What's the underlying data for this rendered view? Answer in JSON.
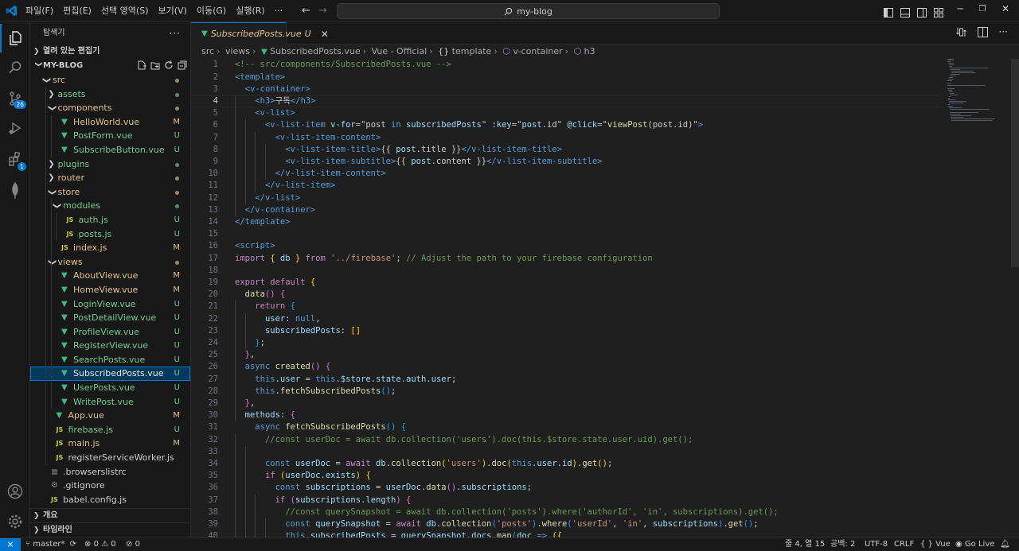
{
  "menus": [
    "파일(F)",
    "편집(E)",
    "선택 영역(S)",
    "보기(V)",
    "이동(G)",
    "실행(R)",
    "···"
  ],
  "command_center": "my-blog",
  "activity": {
    "source_control_badge": "26",
    "extensions_badge": "1"
  },
  "explorer": {
    "title": "탐색기",
    "open_editors": "열려 있는 편집기",
    "folder": "MY-BLOG",
    "tree": [
      {
        "label": "src",
        "depth": 0,
        "type": "folder",
        "open": true,
        "status": "dot-amber"
      },
      {
        "label": "assets",
        "depth": 1,
        "type": "folder",
        "open": false,
        "status": "dot-green"
      },
      {
        "label": "components",
        "depth": 1,
        "type": "folder",
        "open": true,
        "status": "dot-amber"
      },
      {
        "label": "HelloWorld.vue",
        "depth": 2,
        "type": "vue",
        "status": "M"
      },
      {
        "label": "PostForm.vue",
        "depth": 2,
        "type": "vue",
        "status": "U"
      },
      {
        "label": "SubscribeButton.vue",
        "depth": 2,
        "type": "vue",
        "status": "U"
      },
      {
        "label": "plugins",
        "depth": 1,
        "type": "folder",
        "open": false,
        "status": "dot-green"
      },
      {
        "label": "router",
        "depth": 1,
        "type": "folder",
        "open": false,
        "status": "dot-amber"
      },
      {
        "label": "store",
        "depth": 1,
        "type": "folder",
        "open": true,
        "status": "dot-amber"
      },
      {
        "label": "modules",
        "depth": 2,
        "type": "folder",
        "open": true,
        "status": "dot-green"
      },
      {
        "label": "auth.js",
        "depth": 3,
        "type": "js",
        "status": "U"
      },
      {
        "label": "posts.js",
        "depth": 3,
        "type": "js",
        "status": "U"
      },
      {
        "label": "index.js",
        "depth": 2,
        "type": "js",
        "status": "M"
      },
      {
        "label": "views",
        "depth": 1,
        "type": "folder",
        "open": true,
        "status": "dot-amber"
      },
      {
        "label": "AboutView.vue",
        "depth": 2,
        "type": "vue",
        "status": "M"
      },
      {
        "label": "HomeView.vue",
        "depth": 2,
        "type": "vue",
        "status": "M"
      },
      {
        "label": "LoginView.vue",
        "depth": 2,
        "type": "vue",
        "status": "U"
      },
      {
        "label": "PostDetailView.vue",
        "depth": 2,
        "type": "vue",
        "status": "U"
      },
      {
        "label": "ProfileView.vue",
        "depth": 2,
        "type": "vue",
        "status": "U"
      },
      {
        "label": "RegisterView.vue",
        "depth": 2,
        "type": "vue",
        "status": "U"
      },
      {
        "label": "SearchPosts.vue",
        "depth": 2,
        "type": "vue",
        "status": "U"
      },
      {
        "label": "SubscribedPosts.vue",
        "depth": 2,
        "type": "vue",
        "status": "U",
        "selected": true
      },
      {
        "label": "UserPosts.vue",
        "depth": 2,
        "type": "vue",
        "status": "U"
      },
      {
        "label": "WritePost.vue",
        "depth": 2,
        "type": "vue",
        "status": "U"
      },
      {
        "label": "App.vue",
        "depth": 1,
        "type": "vue",
        "status": "M"
      },
      {
        "label": "firebase.js",
        "depth": 1,
        "type": "js",
        "status": "U"
      },
      {
        "label": "main.js",
        "depth": 1,
        "type": "js",
        "status": "M"
      },
      {
        "label": "registerServiceWorker.js",
        "depth": 1,
        "type": "js",
        "status": ""
      },
      {
        "label": ".browserslistrc",
        "depth": 0,
        "type": "text",
        "status": ""
      },
      {
        "label": ".gitignore",
        "depth": 0,
        "type": "gear",
        "status": ""
      },
      {
        "label": "babel.config.js",
        "depth": 0,
        "type": "babel",
        "status": ""
      }
    ],
    "outline": "개요",
    "timeline": "타임라인"
  },
  "tab": {
    "name": "SubscribedPosts.vue",
    "status": "U"
  },
  "breadcrumb": [
    "src",
    "views",
    "SubscribedPosts.vue",
    "Vue - Official",
    "template",
    "v-container",
    "h3"
  ],
  "editor": {
    "current_line": 4,
    "lines": [
      [
        [
          "c-com",
          "<!-- src/components/SubscribedPosts.vue -->"
        ]
      ],
      [
        [
          "c-tag",
          "<template>"
        ]
      ],
      [
        [
          "",
          "  "
        ],
        [
          "c-tag",
          "<v-container>"
        ]
      ],
      [
        [
          "",
          "    "
        ],
        [
          "c-tag",
          "<h3>"
        ],
        [
          "",
          "구독"
        ],
        [
          "c-tag",
          "</h3>"
        ]
      ],
      [
        [
          "",
          "    "
        ],
        [
          "c-tag",
          "<v-list>"
        ]
      ],
      [
        [
          "",
          "      "
        ],
        [
          "c-tag",
          "<v-list-item "
        ],
        [
          "c-attr",
          "v-for"
        ],
        [
          "",
          "="
        ],
        [
          "",
          "\"post "
        ],
        [
          "c-blue",
          "in"
        ],
        [
          "c-var",
          " subscribedPosts"
        ],
        [
          "",
          "\" "
        ],
        [
          "c-attr",
          ":key"
        ],
        [
          "",
          "=\""
        ],
        [
          "c-var",
          "post"
        ],
        [
          "",
          ".id\" "
        ],
        [
          "c-attr",
          "@click"
        ],
        [
          "",
          "=\""
        ],
        [
          "c-fn",
          "viewPost"
        ],
        [
          "",
          "(post.id)\""
        ],
        [
          "c-tag",
          ">"
        ]
      ],
      [
        [
          "",
          "        "
        ],
        [
          "c-tag",
          "<v-list-item-content>"
        ]
      ],
      [
        [
          "",
          "          "
        ],
        [
          "c-tag",
          "<v-list-item-title>"
        ],
        [
          "",
          "{{ "
        ],
        [
          "c-var",
          "post"
        ],
        [
          "",
          ".title }}"
        ],
        [
          "c-tag",
          "</v-list-item-title>"
        ]
      ],
      [
        [
          "",
          "          "
        ],
        [
          "c-tag",
          "<v-list-item-subtitle>"
        ],
        [
          "",
          "{{ "
        ],
        [
          "c-var",
          "post"
        ],
        [
          "",
          ".content }}"
        ],
        [
          "c-tag",
          "</v-list-item-subtitle>"
        ]
      ],
      [
        [
          "",
          "        "
        ],
        [
          "c-tag",
          "</v-list-item-content>"
        ]
      ],
      [
        [
          "",
          "      "
        ],
        [
          "c-tag",
          "</v-list-item>"
        ]
      ],
      [
        [
          "",
          "    "
        ],
        [
          "c-tag",
          "</v-list>"
        ]
      ],
      [
        [
          "",
          "  "
        ],
        [
          "c-tag",
          "</v-container>"
        ]
      ],
      [
        [
          "c-tag",
          "</template>"
        ]
      ],
      [],
      [
        [
          "c-tag",
          "<script>"
        ]
      ],
      [
        [
          "c-kw",
          "import"
        ],
        [
          "",
          " "
        ],
        [
          "c-br",
          "{"
        ],
        [
          "c-var",
          " db "
        ],
        [
          "c-br",
          "}"
        ],
        [
          "c-kw",
          " from"
        ],
        [
          "",
          " "
        ],
        [
          "c-str",
          "'../firebase'"
        ],
        [
          "",
          "; "
        ],
        [
          "c-com",
          "// Adjust the path to your firebase configuration"
        ]
      ],
      [],
      [
        [
          "c-kw",
          "export default"
        ],
        [
          "",
          " "
        ],
        [
          "c-br",
          "{"
        ]
      ],
      [
        [
          "",
          "  "
        ],
        [
          "c-fn",
          "data"
        ],
        [
          "c-br2",
          "()"
        ],
        [
          "",
          " "
        ],
        [
          "c-br2",
          "{"
        ]
      ],
      [
        [
          "",
          "    "
        ],
        [
          "c-kw",
          "return"
        ],
        [
          "",
          " "
        ],
        [
          "c-br3",
          "{"
        ]
      ],
      [
        [
          "",
          "      "
        ],
        [
          "c-var",
          "user"
        ],
        [
          "",
          ": "
        ],
        [
          "c-blue",
          "null"
        ],
        [
          "",
          ","
        ]
      ],
      [
        [
          "",
          "      "
        ],
        [
          "c-var",
          "subscribedPosts"
        ],
        [
          "",
          ": "
        ],
        [
          "c-br",
          "[]"
        ]
      ],
      [
        [
          "",
          "    "
        ],
        [
          "c-br3",
          "}"
        ],
        [
          "",
          ";"
        ]
      ],
      [
        [
          "",
          "  "
        ],
        [
          "c-br2",
          "}"
        ],
        [
          "",
          ","
        ]
      ],
      [
        [
          "",
          "  "
        ],
        [
          "c-blue",
          "async"
        ],
        [
          "",
          " "
        ],
        [
          "c-fn",
          "created"
        ],
        [
          "c-br2",
          "()"
        ],
        [
          "",
          " "
        ],
        [
          "c-br2",
          "{"
        ]
      ],
      [
        [
          "",
          "    "
        ],
        [
          "c-blue",
          "this"
        ],
        [
          "",
          "."
        ],
        [
          "c-var",
          "user"
        ],
        [
          "",
          " = "
        ],
        [
          "c-blue",
          "this"
        ],
        [
          "",
          "."
        ],
        [
          "c-var",
          "$store"
        ],
        [
          "",
          "."
        ],
        [
          "c-var",
          "state"
        ],
        [
          "",
          "."
        ],
        [
          "c-var",
          "auth"
        ],
        [
          "",
          "."
        ],
        [
          "c-var",
          "user"
        ],
        [
          "",
          ";"
        ]
      ],
      [
        [
          "",
          "    "
        ],
        [
          "c-blue",
          "this"
        ],
        [
          "",
          "."
        ],
        [
          "c-fn",
          "fetchSubscribedPosts"
        ],
        [
          "c-br3",
          "()"
        ],
        [
          "",
          ";"
        ]
      ],
      [
        [
          "",
          "  "
        ],
        [
          "c-br2",
          "}"
        ],
        [
          "",
          ","
        ]
      ],
      [
        [
          "",
          "  "
        ],
        [
          "c-var",
          "methods"
        ],
        [
          "",
          ": "
        ],
        [
          "c-br2",
          "{"
        ]
      ],
      [
        [
          "",
          "    "
        ],
        [
          "c-blue",
          "async"
        ],
        [
          "",
          " "
        ],
        [
          "c-fn",
          "fetchSubscribedPosts"
        ],
        [
          "c-br3",
          "()"
        ],
        [
          "",
          " "
        ],
        [
          "c-br3",
          "{"
        ]
      ],
      [
        [
          "",
          "      "
        ],
        [
          "c-com",
          "//const userDoc = await db.collection('users').doc(this.$store.state.user.uid).get();"
        ]
      ],
      [],
      [
        [
          "",
          "      "
        ],
        [
          "c-blue",
          "const"
        ],
        [
          "c-var",
          " userDoc"
        ],
        [
          "",
          " = "
        ],
        [
          "c-kw",
          "await"
        ],
        [
          "c-var",
          " db"
        ],
        [
          "",
          "."
        ],
        [
          "c-fn",
          "collection"
        ],
        [
          "c-br",
          "("
        ],
        [
          "c-str",
          "'users'"
        ],
        [
          "c-br",
          ")"
        ],
        [
          "",
          "."
        ],
        [
          "c-fn",
          "doc"
        ],
        [
          "c-br",
          "("
        ],
        [
          "c-blue",
          "this"
        ],
        [
          "",
          "."
        ],
        [
          "c-var",
          "user"
        ],
        [
          "",
          "."
        ],
        [
          "c-var",
          "id"
        ],
        [
          "c-br",
          ")"
        ],
        [
          "",
          "."
        ],
        [
          "c-fn",
          "get"
        ],
        [
          "c-br",
          "()"
        ],
        [
          "",
          ";"
        ]
      ],
      [
        [
          "",
          "      "
        ],
        [
          "c-kw",
          "if"
        ],
        [
          "",
          " "
        ],
        [
          "c-br",
          "("
        ],
        [
          "c-var",
          "userDoc"
        ],
        [
          "",
          "."
        ],
        [
          "c-var",
          "exists"
        ],
        [
          "c-br",
          ")"
        ],
        [
          "",
          " "
        ],
        [
          "c-br",
          "{"
        ]
      ],
      [
        [
          "",
          "        "
        ],
        [
          "c-blue",
          "const"
        ],
        [
          "c-var",
          " subscriptions"
        ],
        [
          "",
          " = "
        ],
        [
          "c-var",
          "userDoc"
        ],
        [
          "",
          "."
        ],
        [
          "c-fn",
          "data"
        ],
        [
          "c-br2",
          "()"
        ],
        [
          "",
          "."
        ],
        [
          "c-var",
          "subscriptions"
        ],
        [
          "",
          ";"
        ]
      ],
      [
        [
          "",
          "        "
        ],
        [
          "c-kw",
          "if"
        ],
        [
          "",
          " "
        ],
        [
          "c-br2",
          "("
        ],
        [
          "c-var",
          "subscriptions"
        ],
        [
          "",
          "."
        ],
        [
          "c-var",
          "length"
        ],
        [
          "c-br2",
          ")"
        ],
        [
          "",
          " "
        ],
        [
          "c-br2",
          "{"
        ]
      ],
      [
        [
          "",
          "          "
        ],
        [
          "c-com",
          "//const querySnapshot = await db.collection('posts').where('authorId', 'in', subscriptions).get();"
        ]
      ],
      [
        [
          "",
          "          "
        ],
        [
          "c-blue",
          "const"
        ],
        [
          "c-var",
          " querySnapshot"
        ],
        [
          "",
          " = "
        ],
        [
          "c-kw",
          "await"
        ],
        [
          "c-var",
          " db"
        ],
        [
          "",
          "."
        ],
        [
          "c-fn",
          "collection"
        ],
        [
          "c-br3",
          "("
        ],
        [
          "c-str",
          "'posts'"
        ],
        [
          "c-br3",
          ")"
        ],
        [
          "",
          "."
        ],
        [
          "c-fn",
          "where"
        ],
        [
          "c-br3",
          "("
        ],
        [
          "c-str",
          "'userId'"
        ],
        [
          "",
          ", "
        ],
        [
          "c-str",
          "'in'"
        ],
        [
          "",
          ", "
        ],
        [
          "c-var",
          "subscriptions"
        ],
        [
          "c-br3",
          ")"
        ],
        [
          "",
          "."
        ],
        [
          "c-fn",
          "get"
        ],
        [
          "c-br3",
          "()"
        ],
        [
          "",
          ";"
        ]
      ],
      [
        [
          "",
          "          "
        ],
        [
          "c-blue",
          "this"
        ],
        [
          "",
          "."
        ],
        [
          "c-var",
          "subscribedPosts"
        ],
        [
          "",
          " = "
        ],
        [
          "c-var",
          "querySnapshot"
        ],
        [
          "",
          "."
        ],
        [
          "c-var",
          "docs"
        ],
        [
          "",
          "."
        ],
        [
          "c-fn",
          "map"
        ],
        [
          "c-br3",
          "("
        ],
        [
          "c-var",
          "doc"
        ],
        [
          "c-blue",
          " =>"
        ],
        [
          "",
          " "
        ],
        [
          "c-br",
          "({"
        ]
      ]
    ]
  },
  "status": {
    "branch": "master*",
    "errors": "0",
    "warnings": "0",
    "ports": "0",
    "position": "줄 4, 열 15",
    "spaces": "공백: 2",
    "encoding": "UTF-8",
    "eol": "CRLF",
    "language": "Vue",
    "golive": "Go Live"
  },
  "colors": {
    "accent": "#0078d4",
    "modified": "#e2c08d",
    "untracked": "#73c991"
  }
}
